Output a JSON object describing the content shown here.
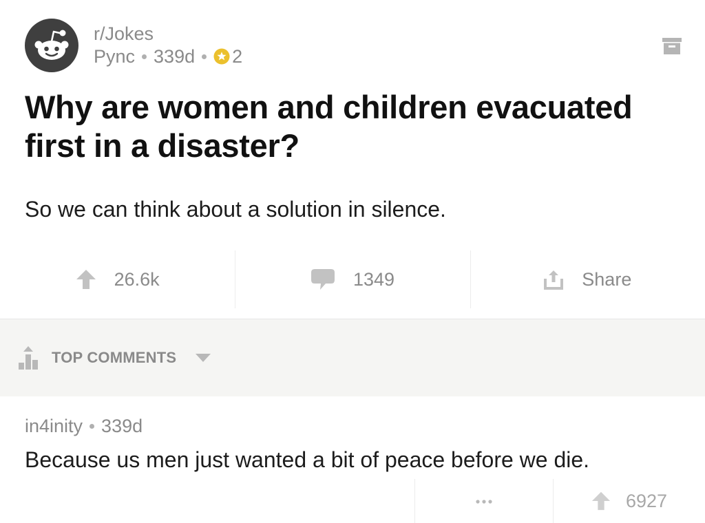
{
  "post": {
    "subreddit": "r/Jokes",
    "author": "Pync",
    "age": "339d",
    "award_count": "2",
    "title": "Why are women and children evacuated first in a disaster?",
    "body": "So we can think about a solution in silence.",
    "icons": {
      "avatar": "reddit-snoo-icon",
      "award": "star-award-icon",
      "archive": "archive-icon"
    }
  },
  "actions": {
    "upvotes": "26.6k",
    "comments": "1349",
    "share_label": "Share",
    "icons": [
      "upvote-arrow-icon",
      "comment-bubble-icon",
      "share-icon"
    ]
  },
  "comments_header": {
    "sort_label": "TOP COMMENTS",
    "icons": [
      "sort-bars-icon",
      "chevron-down-icon"
    ]
  },
  "comment": {
    "author": "in4inity",
    "age": "339d",
    "body": "Because us men just wanted a bit of peace before we die.",
    "upvotes": "6927",
    "icons": [
      "more-options-icon",
      "upvote-arrow-icon"
    ]
  },
  "colors": {
    "award_gold": "#ebc02d",
    "avatar_bg": "#3f3f3f",
    "meta_grey": "#8a8a8a",
    "section_bg": "#f5f5f3"
  }
}
